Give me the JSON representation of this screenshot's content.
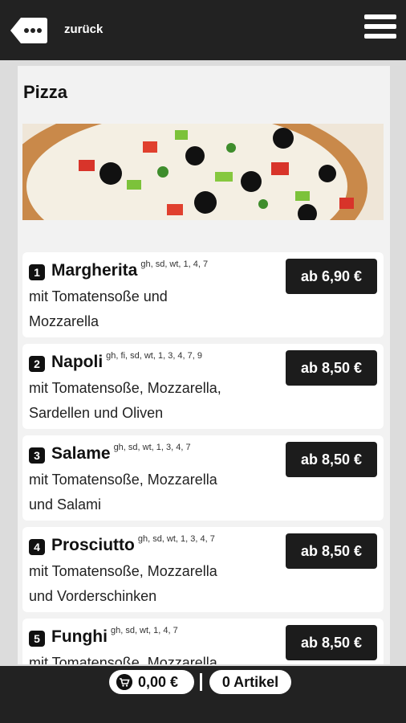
{
  "header": {
    "back_label": "zurück"
  },
  "page": {
    "title": "Pizza"
  },
  "items": [
    {
      "number": "1",
      "name": "Margherita",
      "allergens": "gh, sd, wt, 1, 4, 7",
      "desc_line1": "mit Tomatensoße und",
      "desc_line2": "Mozzarella",
      "price": "ab 6,90 €"
    },
    {
      "number": "2",
      "name": "Napoli",
      "allergens": "gh, fi, sd, wt, 1, 3, 4, 7, 9",
      "desc_line1": "mit Tomatensoße, Mozzarella,",
      "desc_line2": "Sardellen und Oliven",
      "price": "ab 8,50 €"
    },
    {
      "number": "3",
      "name": "Salame",
      "allergens": "gh, sd, wt, 1, 3, 4, 7",
      "desc_line1": "mit Tomatensoße, Mozzarella",
      "desc_line2": "und Salami",
      "price": "ab 8,50 €"
    },
    {
      "number": "4",
      "name": "Prosciutto",
      "allergens": "gh, sd, wt, 1, 3, 4, 7",
      "desc_line1": "mit Tomatensoße, Mozzarella",
      "desc_line2": "und Vorderschinken",
      "price": "ab 8,50 €"
    },
    {
      "number": "5",
      "name": "Funghi",
      "allergens": "gh, sd, wt, 1, 4, 7",
      "desc_line1": "mit Tomatensoße, Mozzarella",
      "desc_line2": "",
      "price": "ab 8,50 €"
    }
  ],
  "cart": {
    "total": "0,00 €",
    "items_count": "0 Artikel"
  },
  "icons": {
    "back": "back-dots-icon",
    "menu": "hamburger-menu-icon",
    "cart": "cart-icon"
  },
  "colors": {
    "bar": "#222222",
    "price_bg": "#1c1c1c",
    "panel": "#f2f2f2"
  }
}
